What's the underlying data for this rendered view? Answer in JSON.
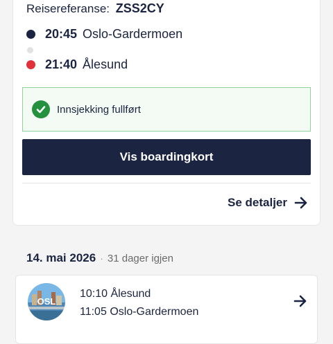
{
  "booking": {
    "ref_label": "Reisereferanse:",
    "ref_code": "ZSS2CY"
  },
  "flight1": {
    "departure": {
      "time": "20:45",
      "place": "Oslo-Gardermoen"
    },
    "arrival": {
      "time": "21:40",
      "place": "Ålesund"
    },
    "checkin_status": "Innsjekking fullført",
    "boarding_button": "Vis boardingkort",
    "details_link": "Se detaljer"
  },
  "upcoming": {
    "date": "14. mai 2026",
    "separator": "·",
    "countdown": "31 dager igjen",
    "avatar_code": "OSL",
    "leg1": {
      "time": "10:10",
      "place": "Ålesund"
    },
    "leg2": {
      "time": "11:05",
      "place": "Oslo-Gardermoen"
    }
  },
  "colors": {
    "navy": "#1b2440",
    "departure_dot": "#1b2440",
    "arrival_dot": "#e0303a",
    "success_green": "#23913d",
    "success_border": "#8fd39a"
  },
  "icons": {
    "check": "check-circle-icon",
    "arrow": "arrow-right-icon"
  }
}
